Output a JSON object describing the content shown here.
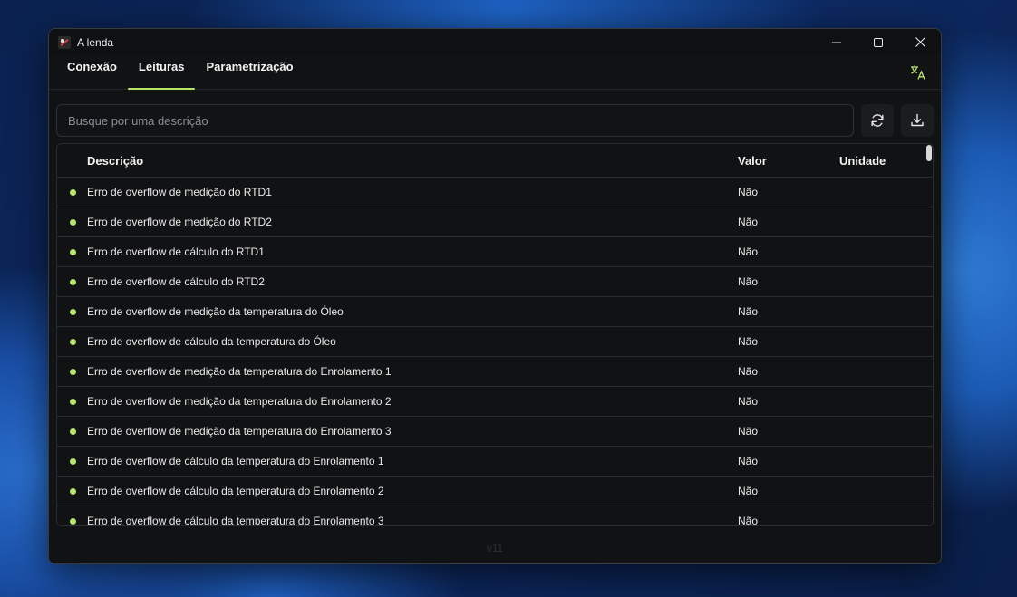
{
  "window": {
    "title": "A lenda"
  },
  "tabs": [
    {
      "label": "Conexão"
    },
    {
      "label": "Leituras"
    },
    {
      "label": "Parametrização"
    }
  ],
  "search": {
    "placeholder": "Busque por uma descrição",
    "value": ""
  },
  "table": {
    "headers": {
      "description": "Descrição",
      "value": "Valor",
      "unit": "Unidade"
    },
    "rows": [
      {
        "description": "Erro de overflow de medição do RTD1",
        "value": "Não",
        "unit": ""
      },
      {
        "description": "Erro de overflow de medição do RTD2",
        "value": "Não",
        "unit": ""
      },
      {
        "description": "Erro de overflow de cálculo do RTD1",
        "value": "Não",
        "unit": ""
      },
      {
        "description": "Erro de overflow de cálculo do RTD2",
        "value": "Não",
        "unit": ""
      },
      {
        "description": "Erro de overflow de medição da temperatura do Óleo",
        "value": "Não",
        "unit": ""
      },
      {
        "description": "Erro de overflow de cálculo da temperatura do Óleo",
        "value": "Não",
        "unit": ""
      },
      {
        "description": "Erro de overflow de medição da temperatura do Enrolamento 1",
        "value": "Não",
        "unit": ""
      },
      {
        "description": "Erro de overflow de medição da temperatura do Enrolamento 2",
        "value": "Não",
        "unit": ""
      },
      {
        "description": "Erro de overflow de medição da temperatura do Enrolamento 3",
        "value": "Não",
        "unit": ""
      },
      {
        "description": "Erro de overflow de cálculo da temperatura do Enrolamento 1",
        "value": "Não",
        "unit": ""
      },
      {
        "description": "Erro de overflow de cálculo da temperatura do Enrolamento 2",
        "value": "Não",
        "unit": ""
      },
      {
        "description": "Erro de overflow de cálculo da temperatura do Enrolamento 3",
        "value": "Não",
        "unit": ""
      }
    ]
  },
  "footer": {
    "version": "v11"
  },
  "colors": {
    "accent": "#b7e66a",
    "background": "#111214",
    "border": "#2a2c30"
  },
  "icons": [
    "app-icon",
    "minimize-icon",
    "maximize-icon",
    "close-icon",
    "translate-icon",
    "refresh-icon",
    "download-icon"
  ]
}
